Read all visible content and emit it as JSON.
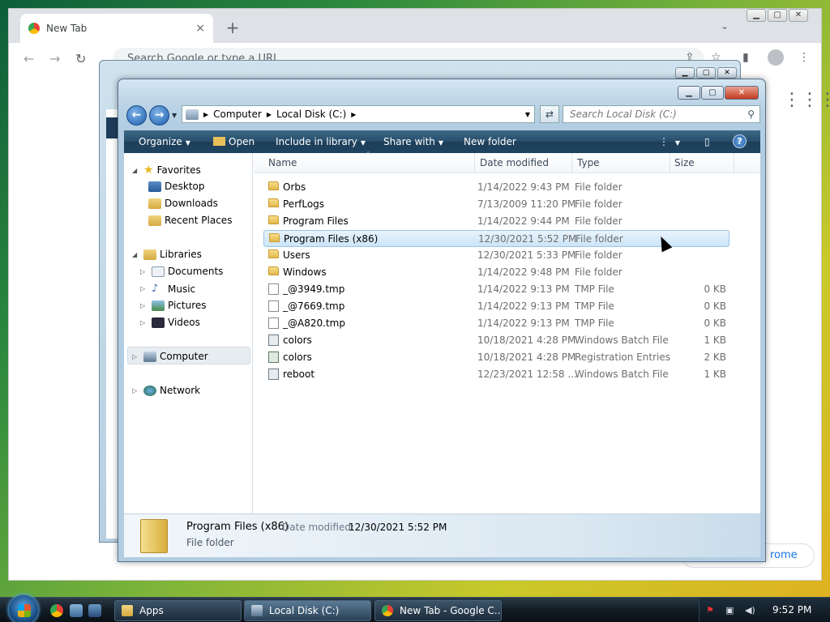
{
  "chrome": {
    "tab_title": "New Tab",
    "tab_close": "×",
    "new_tab": "+",
    "omnibox_placeholder": "Search Google or type a URL",
    "customize_label": "rome",
    "win_buttons": [
      "▁",
      "▢",
      "✕"
    ]
  },
  "explorer_back": {
    "win_buttons": [
      "▁",
      "▢",
      "✕"
    ]
  },
  "explorer": {
    "win_buttons": [
      "▁",
      "▢",
      "✕"
    ],
    "breadcrumb": [
      "Computer",
      "Local Disk (C:)"
    ],
    "search_placeholder": "Search Local Disk (C:)",
    "commands": {
      "organize": "Organize",
      "open": "Open",
      "include": "Include in library",
      "share": "Share with",
      "new_folder": "New folder",
      "help": "?"
    },
    "nav": {
      "favorites": "Favorites",
      "desktop": "Desktop",
      "downloads": "Downloads",
      "recent": "Recent Places",
      "libraries": "Libraries",
      "documents": "Documents",
      "music": "Music",
      "pictures": "Pictures",
      "videos": "Videos",
      "computer": "Computer",
      "network": "Network"
    },
    "columns": {
      "name": "Name",
      "date": "Date modified",
      "type": "Type",
      "size": "Size"
    },
    "files": [
      {
        "name": "Orbs",
        "date": "1/14/2022 9:43 PM",
        "type": "File folder",
        "size": "",
        "kind": "folder"
      },
      {
        "name": "PerfLogs",
        "date": "7/13/2009 11:20 PM",
        "type": "File folder",
        "size": "",
        "kind": "folder"
      },
      {
        "name": "Program Files",
        "date": "1/14/2022 9:44 PM",
        "type": "File folder",
        "size": "",
        "kind": "folder"
      },
      {
        "name": "Program Files (x86)",
        "date": "12/30/2021 5:52 PM",
        "type": "File folder",
        "size": "",
        "kind": "folder"
      },
      {
        "name": "Users",
        "date": "12/30/2021 5:33 PM",
        "type": "File folder",
        "size": "",
        "kind": "folder"
      },
      {
        "name": "Windows",
        "date": "1/14/2022 9:48 PM",
        "type": "File folder",
        "size": "",
        "kind": "folder"
      },
      {
        "name": "_@3949.tmp",
        "date": "1/14/2022 9:13 PM",
        "type": "TMP File",
        "size": "0 KB",
        "kind": "doc"
      },
      {
        "name": "_@7669.tmp",
        "date": "1/14/2022 9:13 PM",
        "type": "TMP File",
        "size": "0 KB",
        "kind": "doc"
      },
      {
        "name": "_@A820.tmp",
        "date": "1/14/2022 9:13 PM",
        "type": "TMP File",
        "size": "0 KB",
        "kind": "doc"
      },
      {
        "name": "colors",
        "date": "10/18/2021 4:28 PM",
        "type": "Windows Batch File",
        "size": "1 KB",
        "kind": "bat"
      },
      {
        "name": "colors",
        "date": "10/18/2021 4:28 PM",
        "type": "Registration Entries",
        "size": "2 KB",
        "kind": "reg"
      },
      {
        "name": "reboot",
        "date": "12/23/2021 12:58 ...",
        "type": "Windows Batch File",
        "size": "1 KB",
        "kind": "bat"
      }
    ],
    "details": {
      "name": "Program Files (x86)",
      "modified_label": "Date modified:",
      "modified_value": "12/30/2021 5:52 PM",
      "type": "File folder"
    }
  },
  "taskbar": {
    "apps": "Apps",
    "local_disk": "Local Disk (C:)",
    "chrome": "New Tab - Google C...",
    "clock": "9:52 PM"
  }
}
